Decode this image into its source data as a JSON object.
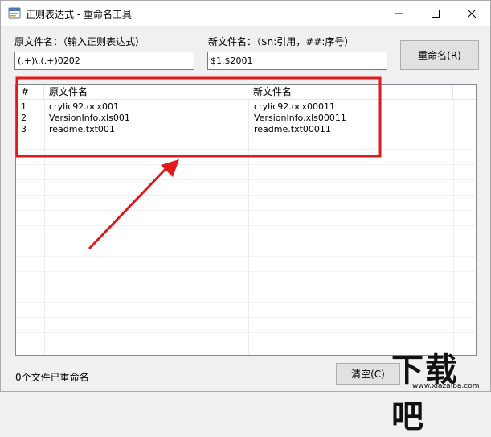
{
  "window": {
    "title": "正则表达式 - 重命名工具",
    "app_icon": "window-app-icon",
    "controls": {
      "minimize": "minimize-icon",
      "maximize": "maximize-icon",
      "close": "close-icon"
    }
  },
  "form": {
    "source_label": "原文件名：（输入正则表达式）",
    "source_value": "(.+)\\.(.+)0202",
    "target_label": "新文件名：（$n:引用，##:序号）",
    "target_value": "$1.$2001",
    "rename_button": "重命名(R)"
  },
  "list": {
    "columns": [
      "#",
      "原文件名",
      "新文件名"
    ],
    "rows": [
      {
        "num": "1",
        "old": "crylic92.ocx001",
        "new": "crylic92.ocx00011"
      },
      {
        "num": "2",
        "old": "VersionInfo.xls001",
        "new": "VersionInfo.xls00011"
      },
      {
        "num": "3",
        "old": "readme.txt001",
        "new": "readme.txt00011"
      }
    ]
  },
  "status": {
    "text": "0个文件已重命名"
  },
  "bottom": {
    "clear_button": "清空(C)"
  },
  "watermark": {
    "text": "下载吧",
    "url": "www.xiazaiba.com"
  },
  "colors": {
    "annotation_red": "#e0191b",
    "window_bg": "#f0f0f0",
    "button_bg": "#e1e1e1"
  }
}
